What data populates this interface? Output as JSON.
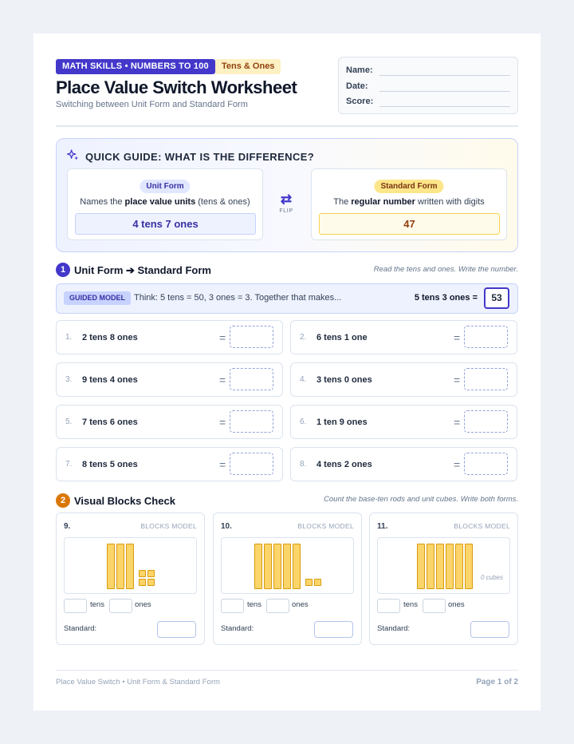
{
  "header": {
    "badge": "MATH SKILLS • NUMBERS TO 100",
    "topic": "Tens & Ones",
    "title": "Place Value Switch Worksheet",
    "subtitle": "Switching between Unit Form and Standard Form",
    "fields": [
      "Name:",
      "Date:",
      "Score:"
    ]
  },
  "guide": {
    "title": "QUICK GUIDE: WHAT IS THE DIFFERENCE?",
    "unit": {
      "label": "Unit Form",
      "desc_pre": "Names the ",
      "desc_bold": "place value units",
      "desc_post": " (tens & ones)",
      "example": "4 tens 7 ones"
    },
    "standard": {
      "label": "Standard Form",
      "desc_pre": "The ",
      "desc_bold": "regular number",
      "desc_post": " written with digits",
      "example": "47"
    },
    "flip_label": "FLIP"
  },
  "section1": {
    "num": "1",
    "title": "Unit Form ➔ Standard Form",
    "note": "Read the tens and ones. Write the number.",
    "model": {
      "tag": "GUIDED MODEL",
      "text": "Think: 5 tens = 50, 3 ones = 3. Together that makes...",
      "eq": "5 tens 3 ones =",
      "answer": "53"
    },
    "problems": [
      {
        "num": "1.",
        "text": "2 tens 8 ones"
      },
      {
        "num": "2.",
        "text": "6 tens 1 one"
      },
      {
        "num": "3.",
        "text": "9 tens 4 ones"
      },
      {
        "num": "4.",
        "text": "3 tens 0 ones"
      },
      {
        "num": "5.",
        "text": "7 tens 6 ones"
      },
      {
        "num": "6.",
        "text": "1 ten 9 ones"
      },
      {
        "num": "7.",
        "text": "8 tens 5 ones"
      },
      {
        "num": "8.",
        "text": "4 tens 2 ones"
      }
    ],
    "eq_sign": "="
  },
  "section2": {
    "num": "2",
    "title": "Visual Blocks Check",
    "note": "Count the base-ten rods and unit cubes. Write both forms.",
    "tag": "BLOCKS MODEL",
    "tens_label": "tens",
    "ones_label": "ones",
    "standard_label": "Standard:",
    "zero_label": "0 cubes",
    "items": [
      {
        "num": "9.",
        "rods": 3,
        "cubes": 4
      },
      {
        "num": "10.",
        "rods": 5,
        "cubes": 2
      },
      {
        "num": "11.",
        "rods": 6,
        "cubes": 0
      }
    ]
  },
  "footer": {
    "left": "Place Value Switch • Unit Form & Standard Form",
    "right": "Page 1 of 2"
  },
  "colors": {
    "accent": "#4338ca",
    "amber": "#d97706",
    "block": "#fcd56a"
  }
}
